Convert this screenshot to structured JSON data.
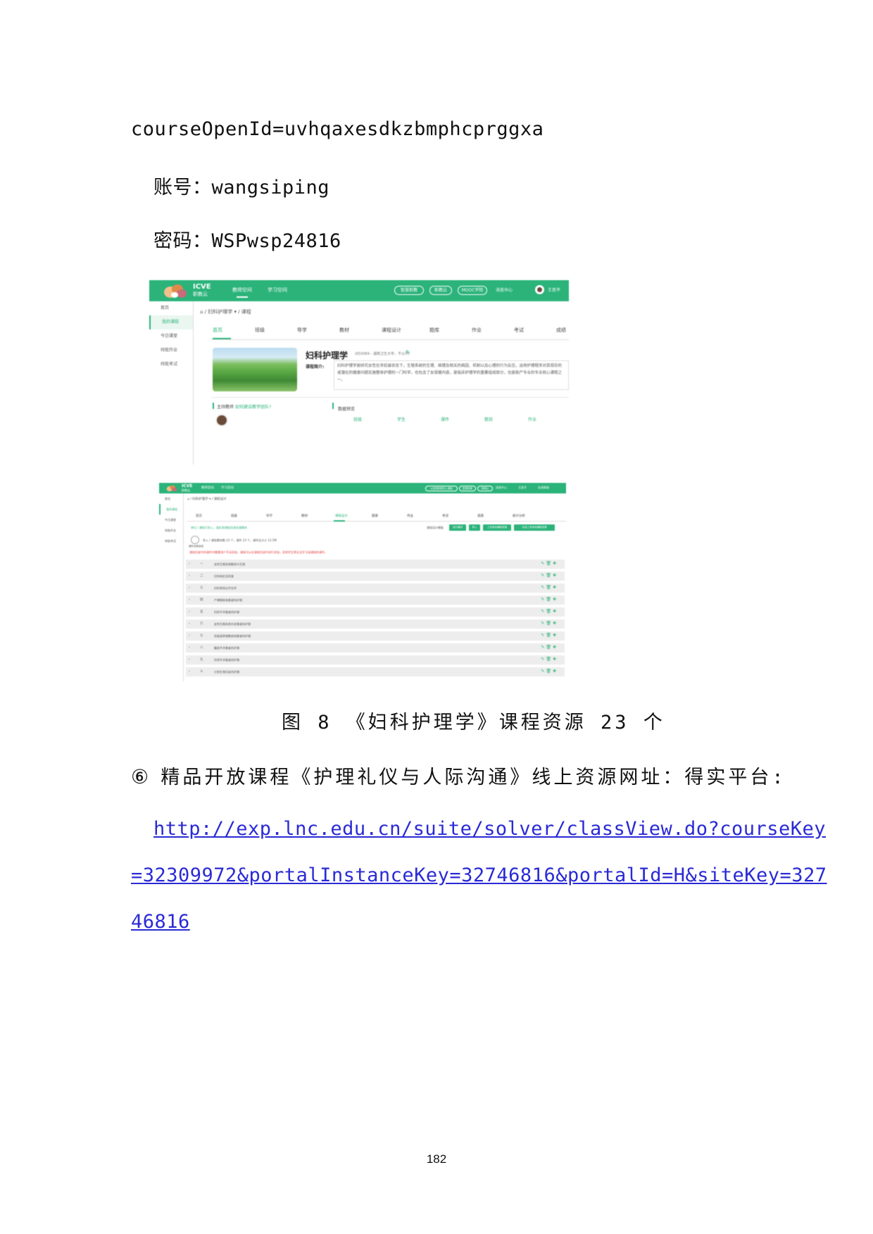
{
  "lines": {
    "course_open_id": "courseOpenId=uvhqaxesdkzbmphcprggxa",
    "account": "账号：wangsiping",
    "password": "密码：WSPwsp24816"
  },
  "figure_caption": "图 8  《妇科护理学》课程资源 23 个",
  "item6": {
    "marker": "⑥",
    "text": "精品开放课程《护理礼仪与人际沟通》线上资源网址：得实平台:"
  },
  "link_lines": [
    "http://exp.lnc.edu.cn/suite/solver/classView.do?courseKey",
    "=32309972&portalInstanceKey=32746816&portalId=H&siteKey=327",
    "46816"
  ],
  "page_number": "182",
  "screenshot1": {
    "brand": "ICVE",
    "brand_sub": "职教云",
    "nav": [
      "教师空间",
      "学习空间"
    ],
    "pills": [
      "智慧职教",
      "职教云",
      "MOOC学院"
    ],
    "message": "消息中心",
    "user": "王思平",
    "sidebar": [
      "首页",
      "我的课程",
      "今日课堂",
      "待批作业",
      "待批考试"
    ],
    "breadcrumb": "⌂ / 妇科护理学 ▾ / 课程",
    "tabs": [
      "首页",
      "班级",
      "导学",
      "教材",
      "课程设计",
      "题库",
      "作业",
      "考试",
      "成绩"
    ],
    "course_title": "妇科护理学",
    "course_meta": "(650084 - 湖南卫生大学，不公开)",
    "intro_label": "课程简介:",
    "intro_text": "妇科护理学是研究女性在非妊娠状态下，生殖系统的生理、病理及相关的病因、机制以及心理的行为反应，运用护理程序对其现存的或潜在的健康问题实施整体护理的一门科学。也包含了女保健内容，是临床护理学的重要组成部分，也是助产专业的专业核心课程之一。",
    "teacher_label": "主持教师",
    "teacher_hint": "如何建设教学团队?",
    "overview_label": "数据预览",
    "stats": [
      "班级",
      "学生",
      "课件",
      "题目",
      "作业"
    ]
  },
  "screenshot2": {
    "brand": "ICVE",
    "brand_sub": "职教云",
    "nav": [
      "教师空间",
      "学习空间"
    ],
    "pills": [
      "从智慧职教导入课程",
      "智慧职教",
      "职教云"
    ],
    "message": "消息中心",
    "user": "王思平",
    "help": "在线帮助",
    "sidebar": [
      "首页",
      "我的课程",
      "今日课堂",
      "待批作业",
      "待批考试"
    ],
    "breadcrumb": "⌂ / 妇科护理学 ▾ / 课程设计",
    "tabs": [
      "首页",
      "班级",
      "导学",
      "教材",
      "课程设计",
      "题库",
      "作业",
      "考试",
      "成绩",
      "统计分析"
    ],
    "info": "单位 / 课程已导入，请先到课程目录处理素材",
    "buttons_label": "课程设计模板",
    "buttons": [
      "设计模块",
      "导入",
      "上传添加课程资源",
      "在线上传添加课程资源"
    ],
    "icon_label": "课件总数信息",
    "stat_line": "导入 / 课程素材数 23 个，课件 23 个，课件总大小 12.5M",
    "warning": "课程目录中的课件均需要用户手动添加，课程可以在课程目录中进行添加，否则学生将无法学习该课程的课件。",
    "chapters": [
      {
        "num": "一",
        "title": "女性生殖系统解剖与生理"
      },
      {
        "num": "二",
        "title": "妇科病史及检查"
      },
      {
        "num": "三",
        "title": "妇科常用诊疗技术"
      },
      {
        "num": "四",
        "title": "产褥期疾病患者的护理"
      },
      {
        "num": "五",
        "title": "妇科手术患者的护理"
      },
      {
        "num": "六",
        "title": "女性生殖系统炎症患者的护理"
      },
      {
        "num": "七",
        "title": "妊娠滋养细胞疾病患者的护理"
      },
      {
        "num": "八",
        "title": "腹部手术患者的护理"
      },
      {
        "num": "九",
        "title": "外阴手术患者的护理"
      },
      {
        "num": "十",
        "title": "计划生育妇女的护理"
      }
    ]
  }
}
